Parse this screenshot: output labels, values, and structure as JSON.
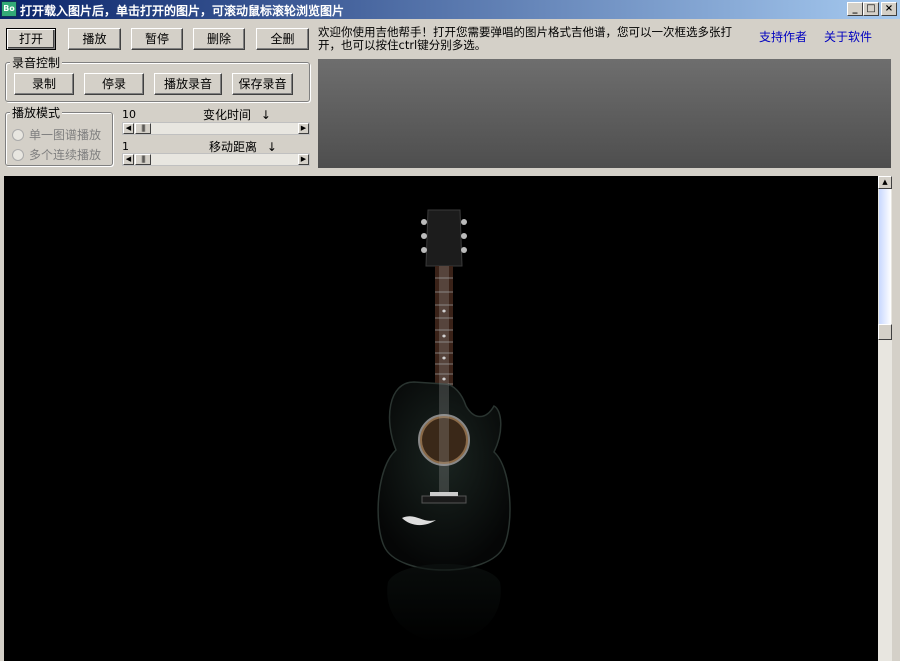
{
  "window": {
    "title": "打开载入图片后，单击打开的图片，可滚动鼠标滚轮浏览图片",
    "icon_text": "Bo",
    "controls": {
      "minimize": "_",
      "maximize": "□",
      "close": "×"
    }
  },
  "toolbar": {
    "open": "打开",
    "play": "播放",
    "pause": "暂停",
    "delete": "删除",
    "delete_all": "全删"
  },
  "info": {
    "message": "欢迎你使用吉他帮手！打开您需要弹唱的图片格式吉他谱，您可以一次框选多张打开，也可以按住ctrl键分别多选。",
    "support_link": "支持作者",
    "about_link": "关于软件"
  },
  "recording": {
    "group_label": "录音控制",
    "record": "录制",
    "stop": "停录",
    "play_recording": "播放录音",
    "save_recording": "保存录音"
  },
  "play_mode": {
    "group_label": "播放模式",
    "options": [
      "单一图谱播放",
      "多个连续播放"
    ]
  },
  "sliders": {
    "change_time": {
      "label": "变化时间",
      "arrow": "↓",
      "value": "10",
      "fraction": 0.0
    },
    "move_distance": {
      "label": "移动距离",
      "arrow": "↓",
      "value": "1",
      "fraction": 0.0
    }
  },
  "icons": {
    "scroll_left": "◀",
    "scroll_right": "▶",
    "scroll_up": "▲",
    "scroll_down": "▼",
    "thumb_grip": "|||"
  }
}
